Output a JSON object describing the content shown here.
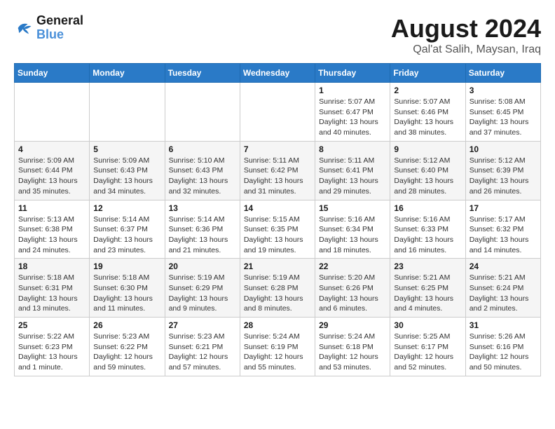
{
  "header": {
    "logo": {
      "text_general": "General",
      "text_blue": "Blue"
    },
    "title": "August 2024",
    "subtitle": "Qal'at Salih, Maysan, Iraq"
  },
  "calendar": {
    "days_of_week": [
      "Sunday",
      "Monday",
      "Tuesday",
      "Wednesday",
      "Thursday",
      "Friday",
      "Saturday"
    ],
    "weeks": [
      [
        {
          "day": "",
          "info": ""
        },
        {
          "day": "",
          "info": ""
        },
        {
          "day": "",
          "info": ""
        },
        {
          "day": "",
          "info": ""
        },
        {
          "day": "1",
          "info": "Sunrise: 5:07 AM\nSunset: 6:47 PM\nDaylight: 13 hours\nand 40 minutes."
        },
        {
          "day": "2",
          "info": "Sunrise: 5:07 AM\nSunset: 6:46 PM\nDaylight: 13 hours\nand 38 minutes."
        },
        {
          "day": "3",
          "info": "Sunrise: 5:08 AM\nSunset: 6:45 PM\nDaylight: 13 hours\nand 37 minutes."
        }
      ],
      [
        {
          "day": "4",
          "info": "Sunrise: 5:09 AM\nSunset: 6:44 PM\nDaylight: 13 hours\nand 35 minutes."
        },
        {
          "day": "5",
          "info": "Sunrise: 5:09 AM\nSunset: 6:43 PM\nDaylight: 13 hours\nand 34 minutes."
        },
        {
          "day": "6",
          "info": "Sunrise: 5:10 AM\nSunset: 6:43 PM\nDaylight: 13 hours\nand 32 minutes."
        },
        {
          "day": "7",
          "info": "Sunrise: 5:11 AM\nSunset: 6:42 PM\nDaylight: 13 hours\nand 31 minutes."
        },
        {
          "day": "8",
          "info": "Sunrise: 5:11 AM\nSunset: 6:41 PM\nDaylight: 13 hours\nand 29 minutes."
        },
        {
          "day": "9",
          "info": "Sunrise: 5:12 AM\nSunset: 6:40 PM\nDaylight: 13 hours\nand 28 minutes."
        },
        {
          "day": "10",
          "info": "Sunrise: 5:12 AM\nSunset: 6:39 PM\nDaylight: 13 hours\nand 26 minutes."
        }
      ],
      [
        {
          "day": "11",
          "info": "Sunrise: 5:13 AM\nSunset: 6:38 PM\nDaylight: 13 hours\nand 24 minutes."
        },
        {
          "day": "12",
          "info": "Sunrise: 5:14 AM\nSunset: 6:37 PM\nDaylight: 13 hours\nand 23 minutes."
        },
        {
          "day": "13",
          "info": "Sunrise: 5:14 AM\nSunset: 6:36 PM\nDaylight: 13 hours\nand 21 minutes."
        },
        {
          "day": "14",
          "info": "Sunrise: 5:15 AM\nSunset: 6:35 PM\nDaylight: 13 hours\nand 19 minutes."
        },
        {
          "day": "15",
          "info": "Sunrise: 5:16 AM\nSunset: 6:34 PM\nDaylight: 13 hours\nand 18 minutes."
        },
        {
          "day": "16",
          "info": "Sunrise: 5:16 AM\nSunset: 6:33 PM\nDaylight: 13 hours\nand 16 minutes."
        },
        {
          "day": "17",
          "info": "Sunrise: 5:17 AM\nSunset: 6:32 PM\nDaylight: 13 hours\nand 14 minutes."
        }
      ],
      [
        {
          "day": "18",
          "info": "Sunrise: 5:18 AM\nSunset: 6:31 PM\nDaylight: 13 hours\nand 13 minutes."
        },
        {
          "day": "19",
          "info": "Sunrise: 5:18 AM\nSunset: 6:30 PM\nDaylight: 13 hours\nand 11 minutes."
        },
        {
          "day": "20",
          "info": "Sunrise: 5:19 AM\nSunset: 6:29 PM\nDaylight: 13 hours\nand 9 minutes."
        },
        {
          "day": "21",
          "info": "Sunrise: 5:19 AM\nSunset: 6:28 PM\nDaylight: 13 hours\nand 8 minutes."
        },
        {
          "day": "22",
          "info": "Sunrise: 5:20 AM\nSunset: 6:26 PM\nDaylight: 13 hours\nand 6 minutes."
        },
        {
          "day": "23",
          "info": "Sunrise: 5:21 AM\nSunset: 6:25 PM\nDaylight: 13 hours\nand 4 minutes."
        },
        {
          "day": "24",
          "info": "Sunrise: 5:21 AM\nSunset: 6:24 PM\nDaylight: 13 hours\nand 2 minutes."
        }
      ],
      [
        {
          "day": "25",
          "info": "Sunrise: 5:22 AM\nSunset: 6:23 PM\nDaylight: 13 hours\nand 1 minute."
        },
        {
          "day": "26",
          "info": "Sunrise: 5:23 AM\nSunset: 6:22 PM\nDaylight: 12 hours\nand 59 minutes."
        },
        {
          "day": "27",
          "info": "Sunrise: 5:23 AM\nSunset: 6:21 PM\nDaylight: 12 hours\nand 57 minutes."
        },
        {
          "day": "28",
          "info": "Sunrise: 5:24 AM\nSunset: 6:19 PM\nDaylight: 12 hours\nand 55 minutes."
        },
        {
          "day": "29",
          "info": "Sunrise: 5:24 AM\nSunset: 6:18 PM\nDaylight: 12 hours\nand 53 minutes."
        },
        {
          "day": "30",
          "info": "Sunrise: 5:25 AM\nSunset: 6:17 PM\nDaylight: 12 hours\nand 52 minutes."
        },
        {
          "day": "31",
          "info": "Sunrise: 5:26 AM\nSunset: 6:16 PM\nDaylight: 12 hours\nand 50 minutes."
        }
      ]
    ]
  }
}
